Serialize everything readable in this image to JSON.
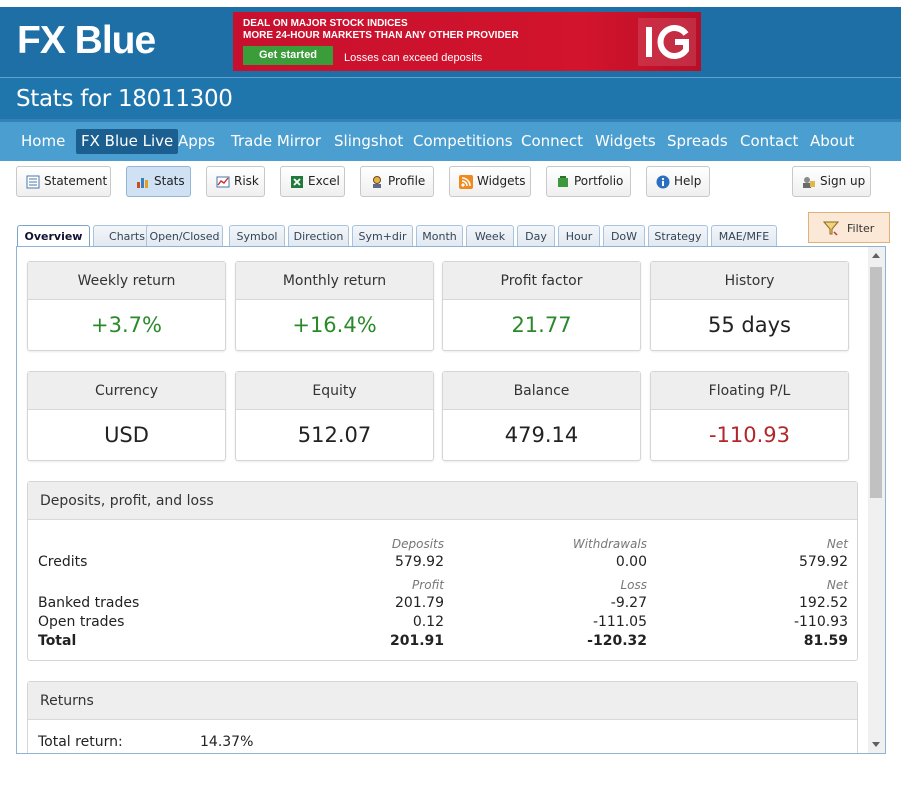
{
  "header": {
    "logo": "FX Blue",
    "ad": {
      "line1": "DEAL ON MAJOR STOCK INDICES",
      "line2": "MORE 24-HOUR MARKETS THAN ANY OTHER PROVIDER",
      "cta": "Get started",
      "disclaimer": "Losses can exceed deposits",
      "brand": "IG"
    },
    "title": "Stats for 18011300"
  },
  "nav": [
    "Home",
    "FX Blue Live",
    "Apps",
    "Trade Mirror",
    "Slingshot",
    "Competitions",
    "Connect",
    "Widgets",
    "Spreads",
    "Contact",
    "About"
  ],
  "nav_active": "FX Blue Live",
  "toolbar": {
    "statement": "Statement",
    "stats": "Stats",
    "risk": "Risk",
    "excel": "Excel",
    "profile": "Profile",
    "widgets": "Widgets",
    "portfolio": "Portfolio",
    "help": "Help",
    "signup": "Sign up"
  },
  "tabs": [
    "Overview",
    "Charts",
    "Open/Closed",
    "Symbol",
    "Direction",
    "Sym+dir",
    "Month",
    "Week",
    "Day",
    "Hour",
    "DoW",
    "Strategy",
    "MAE/MFE"
  ],
  "active_tab": "Overview",
  "filter_label": "Filter",
  "stats": {
    "weekly_return": {
      "label": "Weekly return",
      "value": "+3.7%"
    },
    "monthly_return": {
      "label": "Monthly return",
      "value": "+16.4%"
    },
    "profit_factor": {
      "label": "Profit factor",
      "value": "21.77"
    },
    "history": {
      "label": "History",
      "value": "55 days"
    },
    "currency": {
      "label": "Currency",
      "value": "USD"
    },
    "equity": {
      "label": "Equity",
      "value": "512.07"
    },
    "balance": {
      "label": "Balance",
      "value": "479.14"
    },
    "floating_pl": {
      "label": "Floating P/L",
      "value": "-110.93"
    }
  },
  "colors": {
    "positive": "#2a8a2a",
    "negative": "#b3262a",
    "brand": "#1d6fa5"
  },
  "dpl": {
    "title": "Deposits, profit, and loss",
    "credit_headers": [
      "Deposits",
      "Withdrawals",
      "Net"
    ],
    "credits": {
      "label": "Credits",
      "values": [
        "579.92",
        "0.00",
        "579.92"
      ]
    },
    "trade_headers": [
      "Profit",
      "Loss",
      "Net"
    ],
    "banked": {
      "label": "Banked trades",
      "values": [
        "201.79",
        "-9.27",
        "192.52"
      ]
    },
    "open": {
      "label": "Open trades",
      "values": [
        "0.12",
        "-111.05",
        "-110.93"
      ]
    },
    "total": {
      "label": "Total",
      "values": [
        "201.91",
        "-120.32",
        "81.59"
      ]
    }
  },
  "returns": {
    "title": "Returns",
    "total_label": "Total return:",
    "total_value": "14.37%"
  }
}
